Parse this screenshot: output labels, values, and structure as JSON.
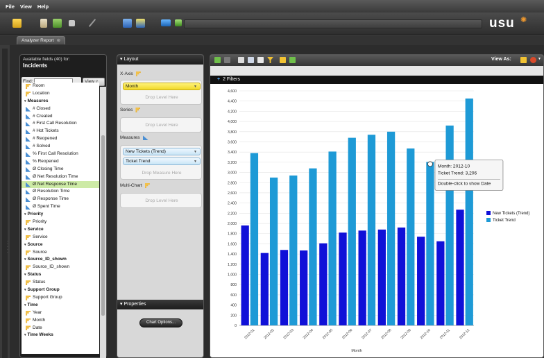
{
  "menu": [
    "File",
    "View",
    "Help"
  ],
  "logo": {
    "text": "usu",
    "accent": "#f29a2e"
  },
  "tab": {
    "label": "Analyzer Report",
    "close": "⊗"
  },
  "fields_panel": {
    "header": "Available fields (40) for:",
    "subject": "Incidents",
    "find_label": "Find:",
    "find_value": "",
    "view_label": "View",
    "items": [
      {
        "type": "hier",
        "label": "Room"
      },
      {
        "type": "hier",
        "label": "Location"
      },
      {
        "type": "group",
        "label": "Measures"
      },
      {
        "type": "measure",
        "label": "# Closed"
      },
      {
        "type": "measure",
        "label": "# Created"
      },
      {
        "type": "measure",
        "label": "# First Call Resolution"
      },
      {
        "type": "measure",
        "label": "# Hot Tickets"
      },
      {
        "type": "measure",
        "label": "# Reopened"
      },
      {
        "type": "measure",
        "label": "# Solved"
      },
      {
        "type": "measure",
        "label": "% First Call Resolution"
      },
      {
        "type": "measure",
        "label": "% Reopened"
      },
      {
        "type": "measure",
        "label": "Ø Closing Time"
      },
      {
        "type": "measure",
        "label": "Ø Net Resolution Time"
      },
      {
        "type": "measure",
        "label": "Ø Net Response Time",
        "selected": true
      },
      {
        "type": "measure",
        "label": "Ø Resolution Time"
      },
      {
        "type": "measure",
        "label": "Ø Response Time"
      },
      {
        "type": "measure",
        "label": "Ø Spent Time"
      },
      {
        "type": "group",
        "label": "Priority"
      },
      {
        "type": "hier",
        "label": "Priority"
      },
      {
        "type": "group",
        "label": "Service"
      },
      {
        "type": "hier",
        "label": "Service"
      },
      {
        "type": "group",
        "label": "Source"
      },
      {
        "type": "hier",
        "label": "Source"
      },
      {
        "type": "group",
        "label": "Source_ID_shown"
      },
      {
        "type": "hier",
        "label": "Source_ID_shown"
      },
      {
        "type": "group",
        "label": "Status"
      },
      {
        "type": "hier",
        "label": "Status"
      },
      {
        "type": "group",
        "label": "Support Group"
      },
      {
        "type": "hier",
        "label": "Support Group"
      },
      {
        "type": "group",
        "label": "Time"
      },
      {
        "type": "hier",
        "label": "Year"
      },
      {
        "type": "hier",
        "label": "Month"
      },
      {
        "type": "hier",
        "label": "Date"
      },
      {
        "type": "group",
        "label": "Time Weeks"
      }
    ]
  },
  "layout_panel": {
    "header": "Layout",
    "xaxis_label": "X-Axis",
    "xaxis_pill": "Month",
    "drop_level": "Drop Level Here",
    "series_label": "Series",
    "measures_label": "Measures",
    "measure_pills": [
      "New Tickets (Trend)",
      "Ticket Trend"
    ],
    "drop_measure": "Drop Measure Here",
    "multichart_label": "Multi-Chart",
    "properties_header": "Properties",
    "chart_options": "Chart Options..."
  },
  "report": {
    "view_as": "View As:",
    "filters": "2 Filters"
  },
  "tooltip": {
    "line1": "Month: 2012-10",
    "line2": "Ticket Trend: 3,206",
    "line3": "Double-click to show Date"
  },
  "chart_data": {
    "type": "bar",
    "categories": [
      "2012-01",
      "2012-02",
      "2012-03",
      "2012-04",
      "2012-05",
      "2012-06",
      "2012-07",
      "2012-08",
      "2012-09",
      "2012-10",
      "2012-11",
      "2012-12"
    ],
    "series": [
      {
        "name": "New Tickets (Trend)",
        "color": "#1010d8",
        "values": [
          1960,
          1420,
          1480,
          1470,
          1610,
          1820,
          1860,
          1880,
          1920,
          1740,
          1650,
          2270
        ]
      },
      {
        "name": "Ticket Trend",
        "color": "#1e9ad6",
        "values": [
          3380,
          2900,
          2940,
          3080,
          3410,
          3680,
          3740,
          3800,
          3470,
          3206,
          3920,
          4450
        ]
      }
    ],
    "xlabel": "Month",
    "ylabel": "",
    "ylim": [
      0,
      4600
    ],
    "yticks": [
      0,
      200,
      400,
      600,
      800,
      1000,
      1200,
      1400,
      1600,
      1800,
      2000,
      2200,
      2400,
      2600,
      2800,
      3000,
      3200,
      3400,
      3600,
      3800,
      4000,
      4200,
      4400,
      4600
    ],
    "ytick_labels": [
      "0",
      "200",
      "400",
      "600",
      "800",
      "1,000",
      "1,200",
      "1,400",
      "1,600",
      "1,800",
      "2,000",
      "2,200",
      "2,400",
      "2,600",
      "2,800",
      "3,000",
      "3,200",
      "3,400",
      "3,600",
      "3,800",
      "4,000",
      "4,200",
      "4,400",
      "4,600"
    ],
    "grid": true,
    "legend": "right"
  }
}
